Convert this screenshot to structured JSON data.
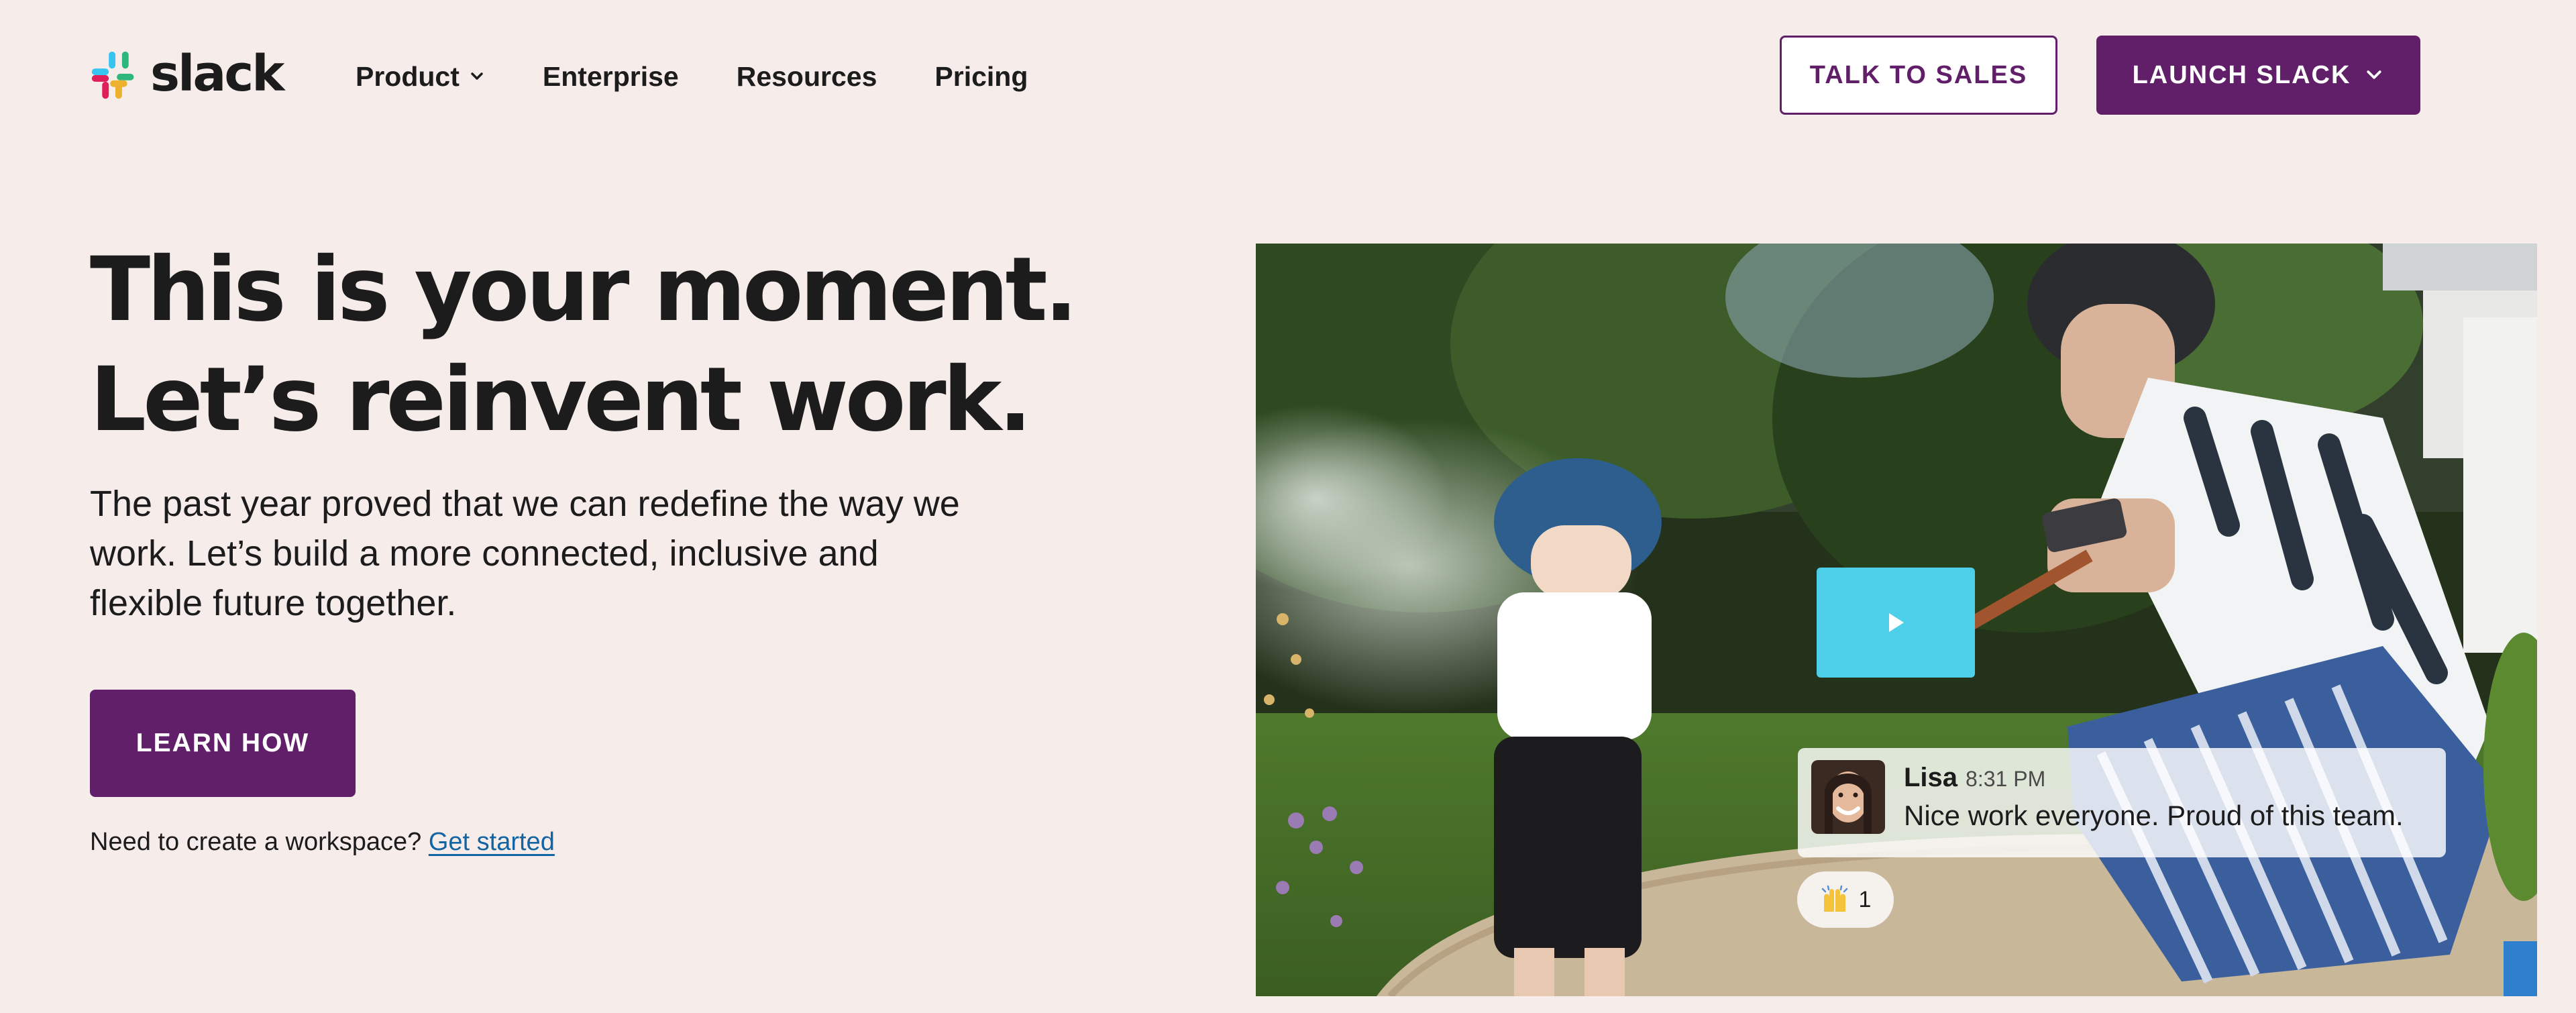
{
  "header": {
    "logo_text": "slack",
    "nav": [
      {
        "label": "Product",
        "has_dropdown": true
      },
      {
        "label": "Enterprise"
      },
      {
        "label": "Resources"
      },
      {
        "label": "Pricing"
      }
    ],
    "talk_to_sales": "TALK TO SALES",
    "launch_slack": "LAUNCH SLACK"
  },
  "hero": {
    "title_line1": "This is your moment.",
    "title_line2": "Let’s reinvent work.",
    "body": "The past year proved that we can redefine the way we work. Let’s build a more connected, inclusive and flexible future together.",
    "cta_label": "LEARN HOW",
    "workspace_prompt": "Need to create a workspace?",
    "workspace_link": "Get started"
  },
  "media": {
    "message": {
      "author": "Lisa",
      "time": "8:31 PM",
      "text": "Nice work everyone. Proud of this team."
    },
    "reaction": {
      "emoji": "raised-hands",
      "count": "1"
    }
  },
  "colors": {
    "background": "#f6ecea",
    "brand_purple": "#611f69",
    "link_blue": "#1264a3",
    "play_cyan": "#4ecfe9"
  }
}
